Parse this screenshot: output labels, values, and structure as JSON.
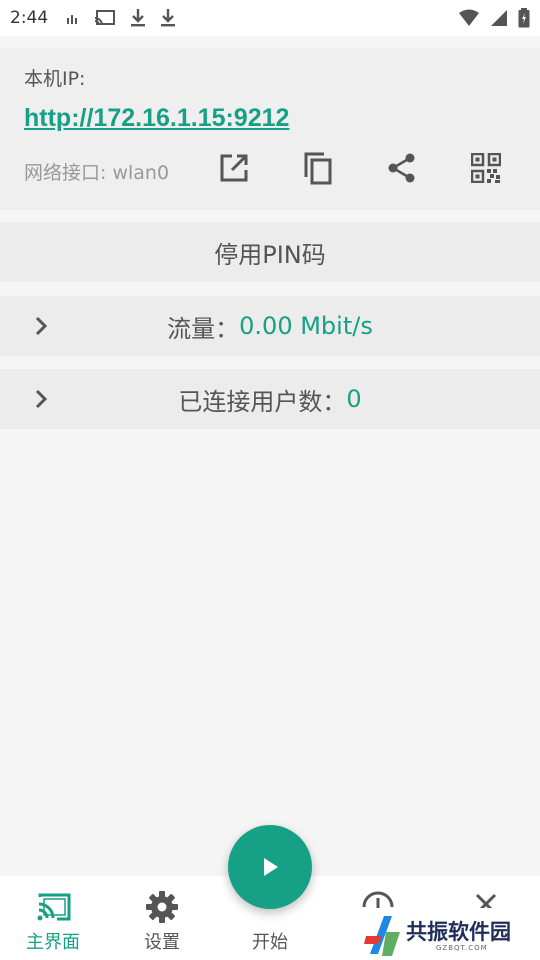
{
  "status_bar": {
    "time": "2:44"
  },
  "ip_card": {
    "label": "本机IP:",
    "url": "http://172.16.1.15:9212",
    "interface": "网络接口: wlan0"
  },
  "pin_row": {
    "label": "停用PIN码"
  },
  "traffic_row": {
    "label": "流量：",
    "value": "0.00 Mbit/s"
  },
  "users_row": {
    "label": "已连接用户数：",
    "value": "0"
  },
  "bottom_nav": {
    "items": [
      {
        "label": "主界面",
        "icon": "cast-icon",
        "active": true
      },
      {
        "label": "设置",
        "icon": "gear-icon",
        "active": false
      },
      {
        "label": "开始",
        "icon": "play-icon",
        "active": false
      }
    ]
  },
  "watermark": {
    "text": "共振软件园",
    "sub": "GZBQT.COM"
  },
  "colors": {
    "accent": "#16a085"
  }
}
